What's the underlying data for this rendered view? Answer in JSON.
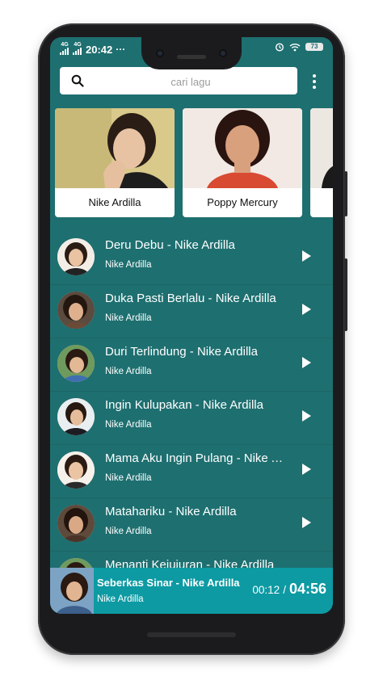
{
  "status_bar": {
    "network_1": "4G",
    "network_2": "4G",
    "time": "20:42",
    "more": "···",
    "battery": "73"
  },
  "search": {
    "placeholder": "cari lagu"
  },
  "artists": [
    {
      "name": "Nike Ardilla"
    },
    {
      "name": "Poppy Mercury"
    }
  ],
  "songs": [
    {
      "title": "Deru Debu - Nike Ardilla",
      "artist": "Nike Ardilla"
    },
    {
      "title": "Duka Pasti Berlalu - Nike Ardilla",
      "artist": "Nike Ardilla"
    },
    {
      "title": "Duri Terlindung - Nike Ardilla",
      "artist": "Nike Ardilla"
    },
    {
      "title": "Ingin Kulupakan - Nike Ardilla",
      "artist": "Nike Ardilla"
    },
    {
      "title": "Mama Aku Ingin Pulang - Nike Ardilla",
      "artist": "Nike Ardilla"
    },
    {
      "title": "Matahariku - Nike Ardilla",
      "artist": "Nike Ardilla"
    },
    {
      "title": "Menanti Kejujuran - Nike Ardilla",
      "artist": ""
    }
  ],
  "player": {
    "title": "Seberkas Sinar - Nike Ardilla",
    "artist": "Nike Ardilla",
    "current_time": "00:12",
    "separator": "/",
    "total_time": "04:56"
  },
  "colors": {
    "background": "#1e6f70",
    "player_bar": "#0d9aa3",
    "card": "#ffffff"
  }
}
